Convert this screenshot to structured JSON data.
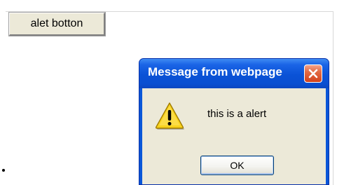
{
  "page": {
    "button_label": "alet botton"
  },
  "dialog": {
    "title": "Message from webpage",
    "message": "this is a alert",
    "ok_label": "OK",
    "icons": {
      "close": "close-icon",
      "warning": "warning-icon"
    }
  },
  "colors": {
    "titlebar": "#0a52d6",
    "close_button": "#d4421b",
    "dialog_background": "#ece9d8",
    "page_button_background": "#ece9d8",
    "warning_fill": "#f8d21c"
  }
}
